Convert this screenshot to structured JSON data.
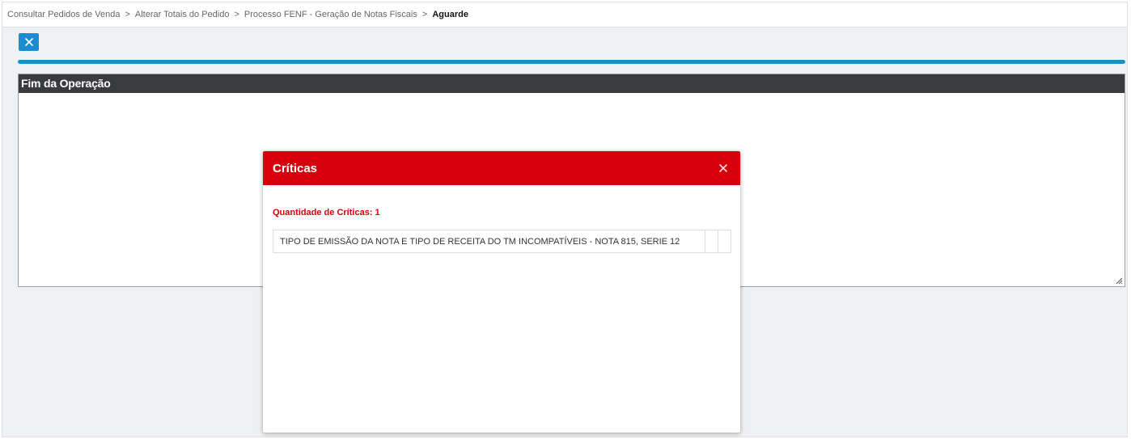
{
  "breadcrumb": {
    "items": [
      "Consultar Pedidos de Venda",
      "Alterar Totais do Pedido",
      "Processo FENF - Geração de Notas Fiscais"
    ],
    "separator": ">",
    "current": "Aguarde"
  },
  "toolbar": {
    "close_icon": "close-icon"
  },
  "progress": {
    "percent": 100,
    "color": "#1c8dc9"
  },
  "panel": {
    "title": "Fim da Operação"
  },
  "modal": {
    "title": "Críticas",
    "header_color": "#d9000d",
    "count_label": "Quantidade de Críticas: 1",
    "rows": [
      {
        "message": "TIPO DE EMISSÃO DA NOTA E TIPO DE RECEITA DO TM INCOMPATÍVEIS - NOTA 815, SERIE 12"
      }
    ]
  }
}
